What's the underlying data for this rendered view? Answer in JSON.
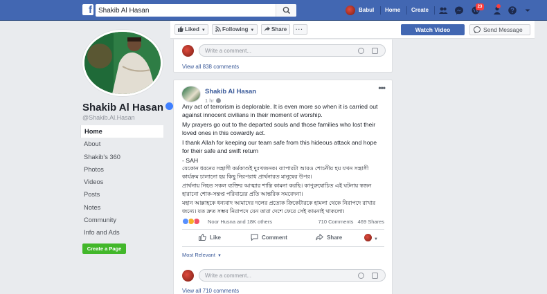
{
  "topbar": {
    "search_value": "Shakib Al Hasan",
    "user_name": "Babul",
    "home_label": "Home",
    "create_label": "Create",
    "notifications_count": "23",
    "brand_color": "#4267b2"
  },
  "page": {
    "name": "Shakib Al Hasan",
    "handle": "@Shakib.Al.Hasan",
    "nav": [
      {
        "label": "Home"
      },
      {
        "label": "About"
      },
      {
        "label": "Shakib's 360"
      },
      {
        "label": "Photos"
      },
      {
        "label": "Videos"
      },
      {
        "label": "Posts"
      },
      {
        "label": "Notes"
      },
      {
        "label": "Community"
      },
      {
        "label": "Info and Ads"
      }
    ],
    "create_page_label": "Create a Page"
  },
  "action_bar": {
    "liked_label": "Liked",
    "following_label": "Following",
    "share_label": "Share",
    "more_label": "···",
    "watch_video_label": "Watch Video",
    "send_message_label": "Send Message"
  },
  "previous_post": {
    "comment_placeholder": "Write a comment...",
    "view_all_comments": "View all 838 comments"
  },
  "post": {
    "author": "Shakib Al Hasan",
    "time": "1 hr",
    "more": "•••",
    "paragraphs": [
      "Any act of terrorism is deplorable. It is even more so when it is carried out against innocent civilians in their moment of worship.",
      "My prayers go out to the departed souls and those families who lost their loved ones in this cowardly act.",
      "I thank Allah for keeping our team safe from this hideous attack and hope for their safe and swift return",
      "- SAH",
      "যেকোন ধরনের সন্ত্রাসী কর্মকাণ্ডই দুঃখজনক। ব্যাপারটা আরও শোচনীয় হয় যখন সন্ত্রাসী কার্যক্রম চালানো হয় কিছু নিরপরাধ প্রার্থনারত মানুষের উপর।",
      "প্রার্থনায় নিহত সকল ব্যক্তির আত্মার শান্তি কামনা করছি। কাপুরুষোচিত এই ঘটনায় স্বজন হারানো শোক-সন্তপ্ত পরিবারের প্রতি আন্তরিক সমবেদনা।",
      "মহান আল্লাহকে ধন্যবাদ আমাদের দলের প্রত্যেক ক্রিকেটারকে হামলা থেকে নিরাপদে রাখার জন্যে। যত দ্রুত সম্ভব নিরাপদে যেন তারা দেশে ফেরে সেই কামনাই থাকলো।"
    ],
    "reactions_names": "Noor Husna and 18K others",
    "comments_count": "710 Comments",
    "shares_count": "469 Shares",
    "like_label": "Like",
    "comment_label": "Comment",
    "share_label": "Share",
    "sort_label": "Most Relevant",
    "comment_placeholder": "Write a comment...",
    "view_all_comments": "View all 710 comments"
  }
}
